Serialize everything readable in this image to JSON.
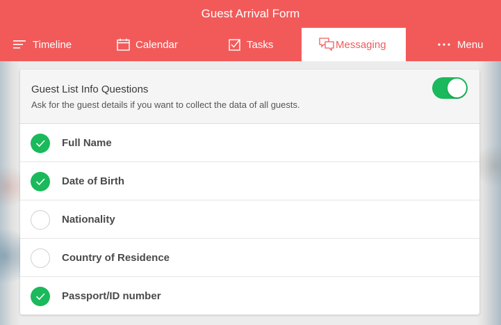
{
  "app": {
    "title": "Guest Arrival Form"
  },
  "tabs": [
    {
      "label": "Timeline",
      "icon": "timeline-icon",
      "active": false
    },
    {
      "label": "Calendar",
      "icon": "calendar-icon",
      "active": false
    },
    {
      "label": "Tasks",
      "icon": "tasks-icon",
      "active": false
    },
    {
      "label": "Messaging",
      "icon": "messaging-icon",
      "active": true
    },
    {
      "label": "Menu",
      "icon": "ellipsis-icon",
      "active": false
    }
  ],
  "section": {
    "title": "Guest List Info Questions",
    "description": "Ask for the guest details if you want to collect the data of all guests.",
    "enabled": true
  },
  "questions": [
    {
      "label": "Full Name",
      "checked": true
    },
    {
      "label": "Date of Birth",
      "checked": true
    },
    {
      "label": "Nationality",
      "checked": false
    },
    {
      "label": "Country of Residence",
      "checked": false
    },
    {
      "label": "Passport/ID number",
      "checked": true
    }
  ],
  "colors": {
    "brand": "#f25a5a",
    "success": "#1ab95b",
    "text": "#4a4a4a"
  }
}
